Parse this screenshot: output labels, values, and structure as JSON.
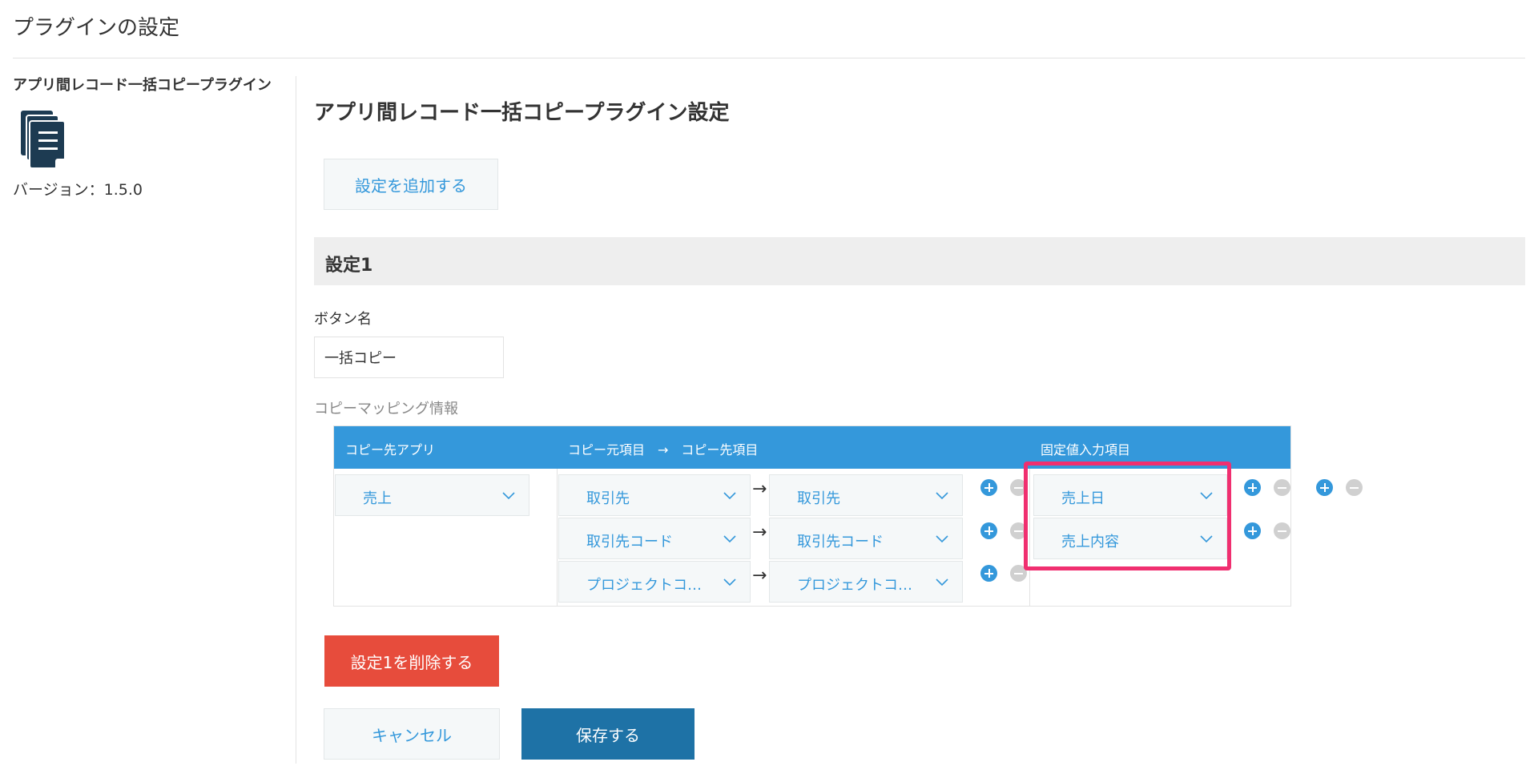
{
  "page": {
    "title": "プラグインの設定"
  },
  "sidebar": {
    "plugin_name": "アプリ間レコード一括コピープラグイン",
    "icon": "document-stack-icon",
    "version": "バージョン：1.5.0"
  },
  "main": {
    "title": "アプリ間レコード一括コピープラグイン設定",
    "add_setting_label": "設定を追加する",
    "section_title": "設定1",
    "button_name_label": "ボタン名",
    "button_name_value": "一括コピー",
    "mapping_label": "コピーマッピング情報",
    "mapping": {
      "headers": {
        "dest_app": "コピー先アプリ",
        "field_map": "コピー元項目　→　コピー先項目",
        "fixed": "固定値入力項目"
      },
      "dest_app": "売上",
      "arrow": "→",
      "rows": [
        {
          "source": "取引先",
          "dest": "取引先"
        },
        {
          "source": "取引先コード",
          "dest": "取引先コード"
        },
        {
          "source": "プロジェクトコ…",
          "dest": "プロジェクトコ…"
        }
      ],
      "fixed_fields": [
        "売上日",
        "売上内容"
      ]
    },
    "delete_label": "設定1を削除する",
    "cancel_label": "キャンセル",
    "save_label": "保存する"
  },
  "colors": {
    "accent": "#3498db",
    "danger": "#e74c3c",
    "primary": "#1e72a6",
    "highlight": "#f02f70"
  }
}
